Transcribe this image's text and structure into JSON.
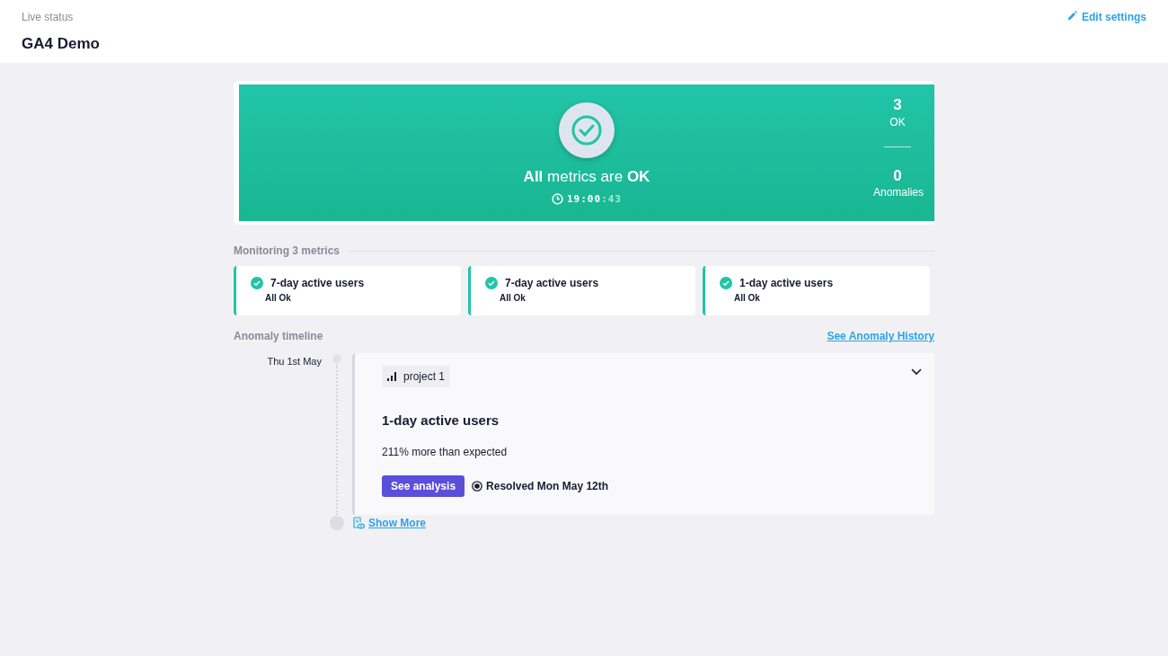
{
  "header": {
    "subtitle": "Live status",
    "title": "GA4 Demo",
    "edit_link": "Edit settings"
  },
  "banner": {
    "message": "**All** metrics are **OK**",
    "time": "19:00",
    "time_seconds": ":43",
    "ok_count": "3",
    "ok_label": "OK",
    "anomaly_count": "0",
    "anomaly_label": "Anomalies"
  },
  "monitoring": {
    "heading": "Monitoring 3 metrics",
    "metrics": [
      {
        "name": "7-day active users",
        "status": "All Ok"
      },
      {
        "name": "7-day active users",
        "status": "All Ok"
      },
      {
        "name": "1-day active users",
        "status": "All Ok"
      }
    ]
  },
  "timeline": {
    "heading": "Anomaly timeline",
    "history_link": "See Anomaly History",
    "entries": [
      {
        "date": "Thu 1st May",
        "project": "project 1",
        "metric": "1-day active users",
        "description": "211% more than expected",
        "button": "See analysis",
        "resolution": "Resolved Mon May 12th",
        "expanded": true
      }
    ],
    "show_more": "Show More"
  }
}
